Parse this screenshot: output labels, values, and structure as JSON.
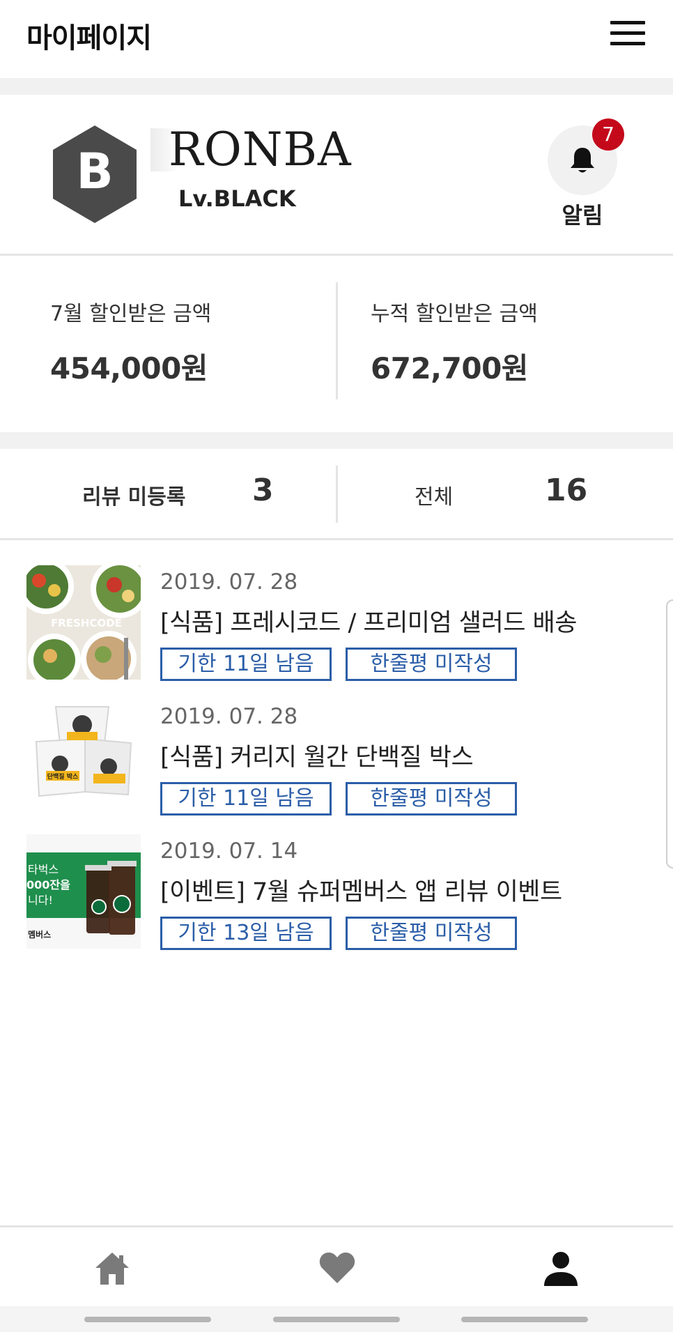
{
  "header": {
    "title": "마이페이지",
    "menu_icon": "hamburger-menu-icon"
  },
  "profile": {
    "badge_letter": "B",
    "badge_icon": "hexagon-level-badge-icon",
    "username": "RONBA",
    "level": "Lv.BLACK",
    "notification": {
      "icon": "bell-icon",
      "count": "7",
      "label": "알림",
      "badge_color": "#c4091b"
    }
  },
  "savings": {
    "month": {
      "label": "7월 할인받은 금액",
      "value": "454,000원"
    },
    "total": {
      "label": "누적 할인받은 금액",
      "value": "672,700원"
    }
  },
  "review_tabs": [
    {
      "label": "리뷰 미등록",
      "count": "3"
    },
    {
      "label": "전체",
      "count": "16"
    }
  ],
  "items": [
    {
      "date": "2019. 07. 28",
      "title": "[식품] 프레시코드 / 프리미엄 샐러드 배송",
      "deadline": "기한 11일 남음",
      "review": "한줄평 미작성",
      "thumb_text": "FRESHCODE"
    },
    {
      "date": "2019. 07. 28",
      "title": "[식품] 커리지 월간 단백질 박스",
      "deadline": "기한 11일 남음",
      "review": "한줄평 미작성",
      "thumb_text": "단백질 박스"
    },
    {
      "date": "2019. 07. 14",
      "title": "[이벤트] 7월 슈퍼멤버스 앱 리뷰 이벤트",
      "deadline": "기한 13일 남음",
      "review": "한줄평 미작성",
      "thumb_lines": [
        "타벅스",
        "000잔을",
        "니다!"
      ],
      "thumb_tag": "멤버스"
    }
  ],
  "bottom_nav": [
    {
      "icon": "home-icon",
      "active": false
    },
    {
      "icon": "heart-icon",
      "active": false
    },
    {
      "icon": "person-icon",
      "active": true
    }
  ],
  "colors": {
    "accent_blue": "#2b5ea8",
    "badge_red": "#c4091b",
    "badge_gray": "#4a4a4a"
  }
}
